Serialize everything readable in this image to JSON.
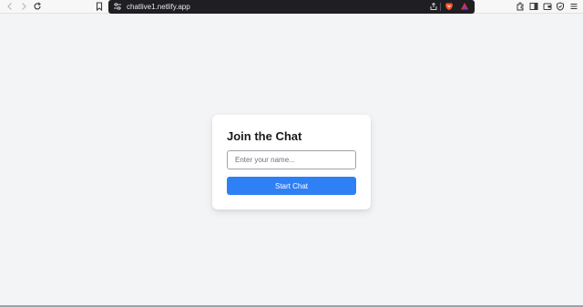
{
  "browser": {
    "url": "chatlive1.netlify.app",
    "icons": {
      "back": "back-arrow-icon",
      "forward": "forward-arrow-icon",
      "reload": "reload-icon",
      "bookmark": "bookmark-icon",
      "site_settings": "site-settings-icon",
      "share": "share-icon",
      "brave_shields": "brave-lion-icon",
      "brave_rewards": "brave-rewards-icon",
      "extensions": "extensions-icon",
      "sidebar": "sidebar-icon",
      "wallet": "wallet-icon",
      "vpn": "vpn-shield-icon",
      "menu": "menu-icon"
    },
    "colors": {
      "urlbar_bg": "#1f1f23",
      "brave_orange": "#fb542b",
      "rewards_red": "#d9363e"
    }
  },
  "page": {
    "background": "#f3f4f6",
    "card": {
      "title": "Join the Chat",
      "name_input": {
        "placeholder": "Enter your name...",
        "value": ""
      },
      "start_button": {
        "label": "Start Chat",
        "color": "#2f80f5"
      }
    }
  }
}
